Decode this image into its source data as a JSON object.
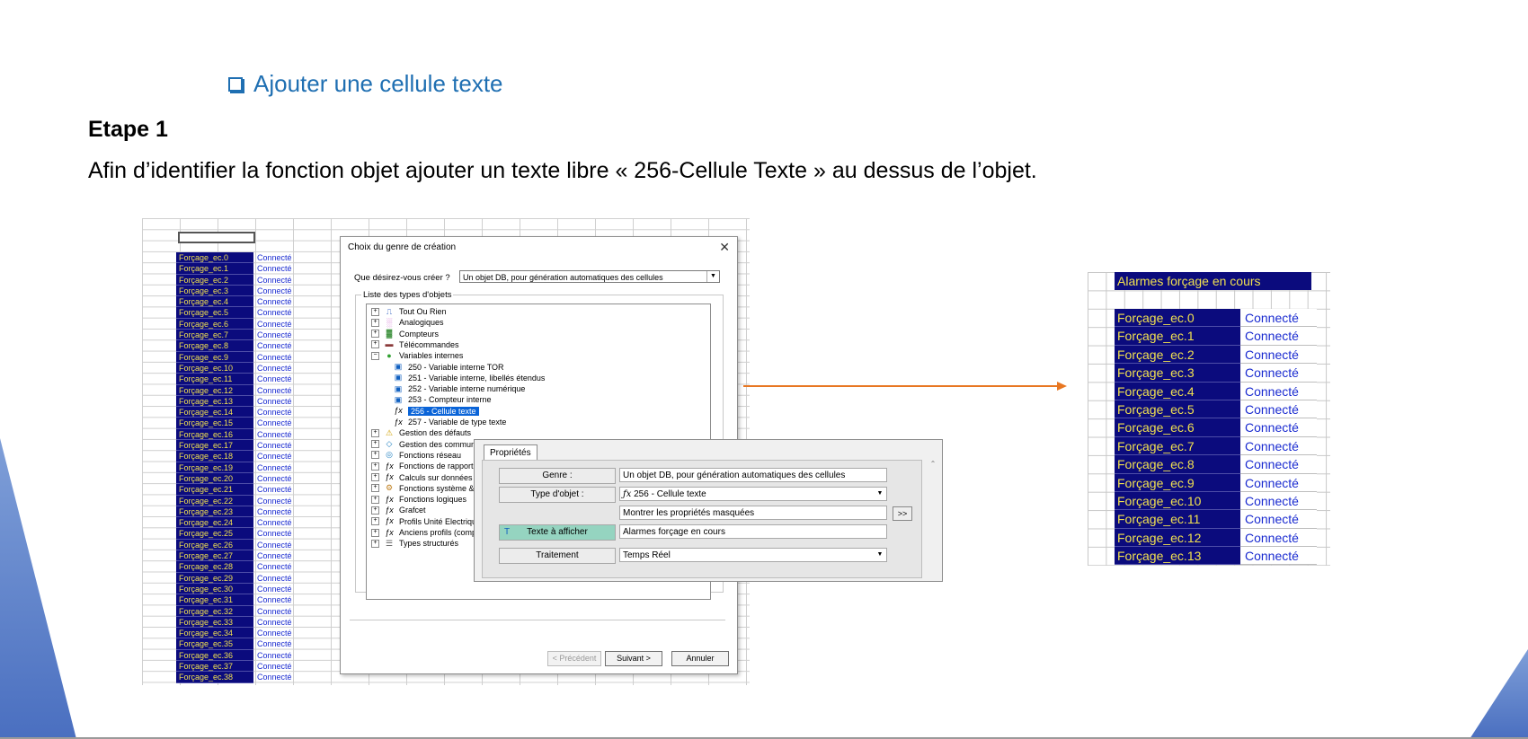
{
  "slide": {
    "heading": "Ajouter une cellule texte",
    "step": "Etape 1",
    "description": "Afin d’identifier la fonction objet ajouter un texte libre « 256-Cellule Texte » au dessus de l’objet."
  },
  "sheet_rows": [
    {
      "name": "Forçage_ec.0",
      "status": "Connecté"
    },
    {
      "name": "Forçage_ec.1",
      "status": "Connecté"
    },
    {
      "name": "Forçage_ec.2",
      "status": "Connecté"
    },
    {
      "name": "Forçage_ec.3",
      "status": "Connecté"
    },
    {
      "name": "Forçage_ec.4",
      "status": "Connecté"
    },
    {
      "name": "Forçage_ec.5",
      "status": "Connecté"
    },
    {
      "name": "Forçage_ec.6",
      "status": "Connecté"
    },
    {
      "name": "Forçage_ec.7",
      "status": "Connecté"
    },
    {
      "name": "Forçage_ec.8",
      "status": "Connecté"
    },
    {
      "name": "Forçage_ec.9",
      "status": "Connecté"
    },
    {
      "name": "Forçage_ec.10",
      "status": "Connecté"
    },
    {
      "name": "Forçage_ec.11",
      "status": "Connecté"
    },
    {
      "name": "Forçage_ec.12",
      "status": "Connecté"
    },
    {
      "name": "Forçage_ec.13",
      "status": "Connecté"
    },
    {
      "name": "Forçage_ec.14",
      "status": "Connecté"
    },
    {
      "name": "Forçage_ec.15",
      "status": "Connecté"
    },
    {
      "name": "Forçage_ec.16",
      "status": "Connecté"
    },
    {
      "name": "Forçage_ec.17",
      "status": "Connecté"
    },
    {
      "name": "Forçage_ec.18",
      "status": "Connecté"
    },
    {
      "name": "Forçage_ec.19",
      "status": "Connecté"
    },
    {
      "name": "Forçage_ec.20",
      "status": "Connecté"
    },
    {
      "name": "Forçage_ec.21",
      "status": "Connecté"
    },
    {
      "name": "Forçage_ec.22",
      "status": "Connecté"
    },
    {
      "name": "Forçage_ec.23",
      "status": "Connecté"
    },
    {
      "name": "Forçage_ec.24",
      "status": "Connecté"
    },
    {
      "name": "Forçage_ec.25",
      "status": "Connecté"
    },
    {
      "name": "Forçage_ec.26",
      "status": "Connecté"
    },
    {
      "name": "Forçage_ec.27",
      "status": "Connecté"
    },
    {
      "name": "Forçage_ec.28",
      "status": "Connecté"
    },
    {
      "name": "Forçage_ec.29",
      "status": "Connecté"
    },
    {
      "name": "Forçage_ec.30",
      "status": "Connecté"
    },
    {
      "name": "Forçage_ec.31",
      "status": "Connecté"
    },
    {
      "name": "Forçage_ec.32",
      "status": "Connecté"
    },
    {
      "name": "Forçage_ec.33",
      "status": "Connecté"
    },
    {
      "name": "Forçage_ec.34",
      "status": "Connecté"
    },
    {
      "name": "Forçage_ec.35",
      "status": "Connecté"
    },
    {
      "name": "Forçage_ec.36",
      "status": "Connecté"
    },
    {
      "name": "Forçage_ec.37",
      "status": "Connecté"
    },
    {
      "name": "Forçage_ec.38",
      "status": "Connecté"
    }
  ],
  "dialog": {
    "title": "Choix du genre de création",
    "question_label": "Que désirez-vous créer ?",
    "question_value": "Un objet DB, pour génération automatiques des cellules",
    "list_label": "Liste des types d'objets",
    "tree": [
      {
        "label": "Tout Ou Rien",
        "level": 0,
        "expander": "+",
        "icon": "tor-icon",
        "glyph": "⎍",
        "color": "#3060c0"
      },
      {
        "label": "Analogiques",
        "level": 0,
        "expander": "+",
        "icon": "analog-icon",
        "glyph": "░",
        "color": "#c040c0"
      },
      {
        "label": "Compteurs",
        "level": 0,
        "expander": "+",
        "icon": "counter-icon",
        "glyph": "▓",
        "color": "#208020"
      },
      {
        "label": "Télécommandes",
        "level": 0,
        "expander": "+",
        "icon": "remote-icon",
        "glyph": "▬",
        "color": "#8a3a3a"
      },
      {
        "label": "Variables internes",
        "level": 0,
        "expander": "−",
        "icon": "internal-vars-icon",
        "glyph": "●",
        "color": "#30a030"
      },
      {
        "label": "250 - Variable interne TOR",
        "level": 1,
        "icon": "var-tor-icon",
        "glyph": "▣",
        "color": "#1060c0"
      },
      {
        "label": "251 - Variable interne, libellés étendus",
        "level": 1,
        "icon": "var-label-icon",
        "glyph": "▣",
        "color": "#1060c0"
      },
      {
        "label": "252 - Variable interne numérique",
        "level": 1,
        "icon": "var-num-icon",
        "glyph": "▣",
        "color": "#1060c0"
      },
      {
        "label": "253 - Compteur interne",
        "level": 1,
        "icon": "var-counter-icon",
        "glyph": "▣",
        "color": "#1060c0"
      },
      {
        "label": "256 - Cellule texte",
        "level": 1,
        "icon": "fx-icon",
        "glyph": "ƒx",
        "color": "#000000",
        "selected": true
      },
      {
        "label": "257 - Variable de type texte",
        "level": 1,
        "icon": "fx-icon",
        "glyph": "ƒx",
        "color": "#000000"
      },
      {
        "label": "Gestion des défauts",
        "level": 0,
        "expander": "+",
        "icon": "warning-icon",
        "glyph": "⚠",
        "color": "#d0a000"
      },
      {
        "label": "Gestion des commun",
        "level": 0,
        "expander": "+",
        "icon": "comm-icon",
        "glyph": "◇",
        "color": "#2080c0"
      },
      {
        "label": "Fonctions réseau",
        "level": 0,
        "expander": "+",
        "icon": "network-icon",
        "glyph": "◎",
        "color": "#2080c0"
      },
      {
        "label": "Fonctions de rapport",
        "level": 0,
        "expander": "+",
        "icon": "fx-icon",
        "glyph": "ƒx",
        "color": "#000000"
      },
      {
        "label": "Calculs sur données",
        "level": 0,
        "expander": "+",
        "icon": "fx-icon",
        "glyph": "ƒx",
        "color": "#000000"
      },
      {
        "label": "Fonctions système &",
        "level": 0,
        "expander": "+",
        "icon": "system-icon",
        "glyph": "⚙",
        "color": "#c08020"
      },
      {
        "label": "Fonctions logiques",
        "level": 0,
        "expander": "+",
        "icon": "fx-icon",
        "glyph": "ƒx",
        "color": "#000000"
      },
      {
        "label": "Grafcet",
        "level": 0,
        "expander": "+",
        "icon": "fx-icon",
        "glyph": "ƒx",
        "color": "#000000"
      },
      {
        "label": "Profils Unité Electriqu",
        "level": 0,
        "expander": "+",
        "icon": "fx-icon",
        "glyph": "ƒx",
        "color": "#000000"
      },
      {
        "label": "Anciens profils (comp",
        "level": 0,
        "expander": "+",
        "icon": "fx-icon",
        "glyph": "ƒx",
        "color": "#000000"
      },
      {
        "label": "Types structurés",
        "level": 0,
        "expander": "+",
        "icon": "struct-icon",
        "glyph": "☰",
        "color": "#606060"
      }
    ],
    "btn_prev": "< Précédent",
    "btn_next": "Suivant >",
    "btn_cancel": "Annuler"
  },
  "props": {
    "tab": "Propriétés",
    "genre_label": "Genre :",
    "genre_value": "Un objet DB, pour génération automatiques des cellules",
    "type_label": "Type d'objet :",
    "type_value": "256 - Cellule texte",
    "hidden_props": "Montrer les propriétés masquées",
    "expand_btn": ">>",
    "text_label": "Texte à afficher",
    "text_value": "Alarmes forçage en cours",
    "treatment_label": "Traitement",
    "treatment_value": "Temps Réel"
  },
  "result": {
    "title": "Alarmes forçage en cours",
    "rows": [
      {
        "name": "Forçage_ec.0",
        "status": "Connecté"
      },
      {
        "name": "Forçage_ec.1",
        "status": "Connecté"
      },
      {
        "name": "Forçage_ec.2",
        "status": "Connecté"
      },
      {
        "name": "Forçage_ec.3",
        "status": "Connecté"
      },
      {
        "name": "Forçage_ec.4",
        "status": "Connecté"
      },
      {
        "name": "Forçage_ec.5",
        "status": "Connecté"
      },
      {
        "name": "Forçage_ec.6",
        "status": "Connecté"
      },
      {
        "name": "Forçage_ec.7",
        "status": "Connecté"
      },
      {
        "name": "Forçage_ec.8",
        "status": "Connecté"
      },
      {
        "name": "Forçage_ec.9",
        "status": "Connecté"
      },
      {
        "name": "Forçage_ec.10",
        "status": "Connecté"
      },
      {
        "name": "Forçage_ec.11",
        "status": "Connecté"
      },
      {
        "name": "Forçage_ec.12",
        "status": "Connecté"
      },
      {
        "name": "Forçage_ec.13",
        "status": "Connecté"
      }
    ]
  },
  "colors": {
    "heading": "#1f6fb2",
    "cell_bg": "#0b0b7d",
    "cell_text": "#f0e050",
    "status_text": "#1a2bd0",
    "arrow": "#e87722",
    "selection": "#0a64d8"
  }
}
